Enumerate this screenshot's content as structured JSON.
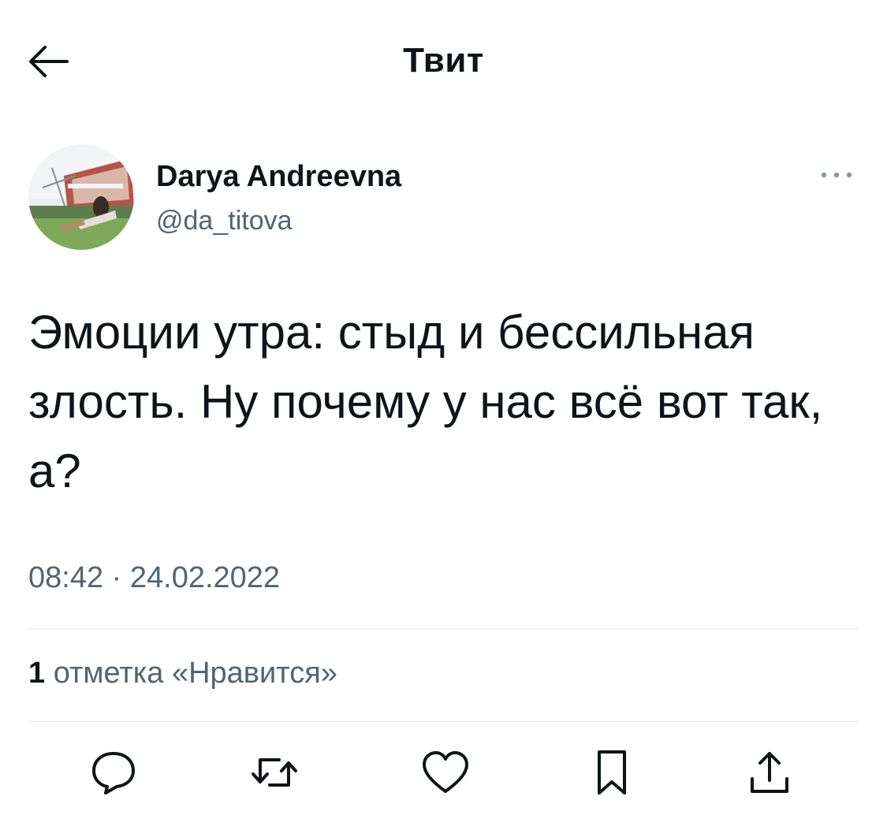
{
  "header": {
    "title": "Твит"
  },
  "author": {
    "display_name": "Darya Andreevna",
    "handle": "@da_titova"
  },
  "tweet": {
    "text": "Эмоции утра: стыд и бессильная злость. Ну почему у нас всё вот так, а?",
    "time": "08:42",
    "separator": "·",
    "date": "24.02.2022"
  },
  "stats": {
    "likes_count": "1",
    "likes_label": "отметка «Нравится»"
  },
  "icons": {
    "back": "arrow-left-icon",
    "more": "more-dots-icon",
    "reply": "reply-icon",
    "retweet": "retweet-icon",
    "like": "heart-icon",
    "bookmark": "bookmark-icon",
    "share": "share-icon"
  },
  "colors": {
    "text_primary": "#0f1419",
    "text_secondary": "#536471",
    "divider": "#e1e6ea",
    "icon": "#536471"
  }
}
